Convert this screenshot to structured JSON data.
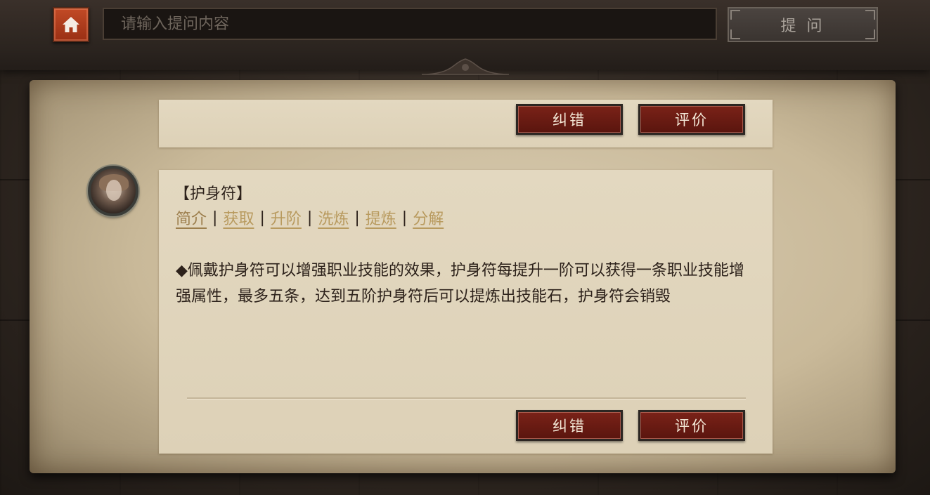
{
  "header": {
    "search_placeholder": "请输入提问内容",
    "ask_label": "提 问"
  },
  "card_top": {
    "correct_label": "纠错",
    "rate_label": "评价"
  },
  "card_main": {
    "title": "【护身符】",
    "tabs": [
      {
        "label": "简介",
        "active": true
      },
      {
        "label": "获取"
      },
      {
        "label": "升阶"
      },
      {
        "label": "洗炼"
      },
      {
        "label": "提炼"
      },
      {
        "label": "分解"
      }
    ],
    "separator": "|",
    "description": "◆佩戴护身符可以增强职业技能的效果，护身符每提升一阶可以获得一条职业技能增强属性，最多五条，达到五阶护身符后可以提炼出技能石，护身符会销毁",
    "correct_label": "纠错",
    "rate_label": "评价"
  },
  "colors": {
    "accent_red": "#7a2218",
    "home_orange": "#c24a26",
    "link_gold": "#b89a5e",
    "parchment": "#ddd1b7"
  },
  "icons": {
    "home": "house-icon",
    "avatar": "character-portrait"
  }
}
